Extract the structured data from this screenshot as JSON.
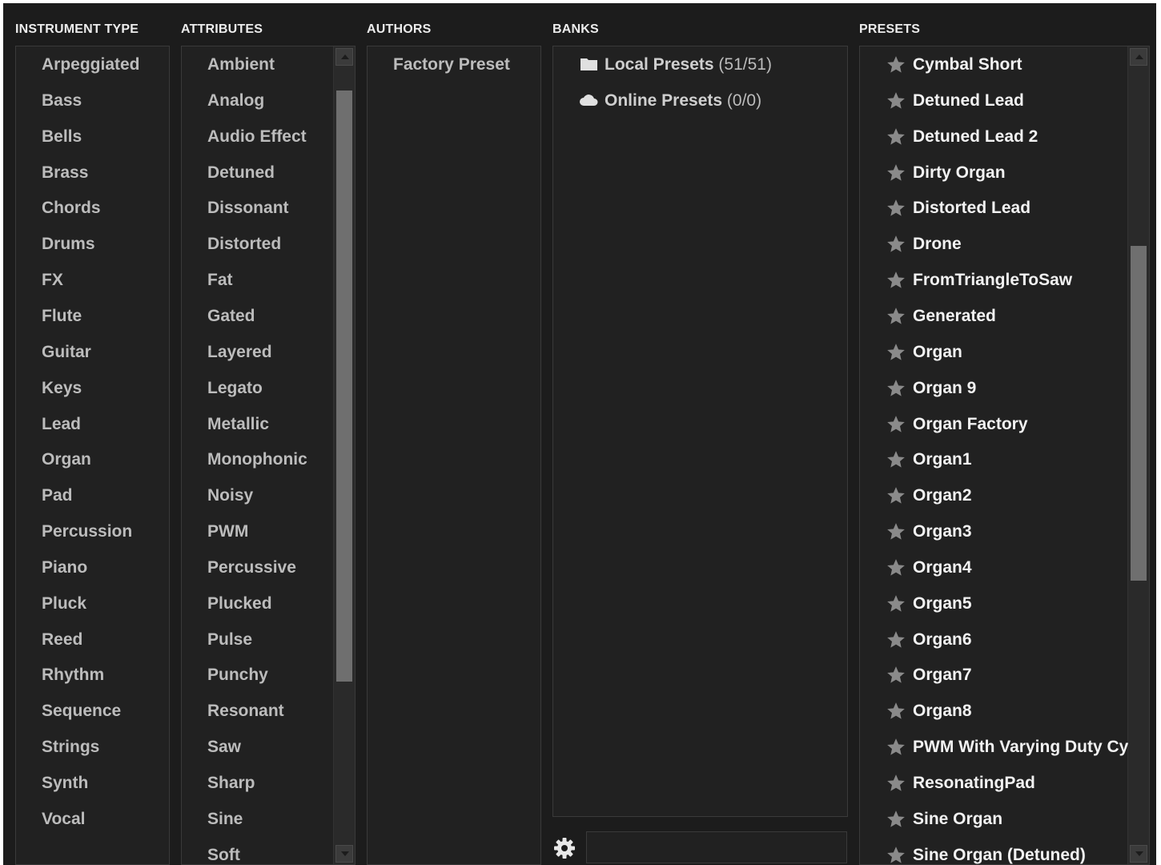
{
  "headers": {
    "instrument_type": "INSTRUMENT TYPE",
    "attributes": "ATTRIBUTES",
    "authors": "AUTHORS",
    "banks": "BANKS",
    "presets": "PRESETS"
  },
  "instrument_types": [
    "Arpeggiated",
    "Bass",
    "Bells",
    "Brass",
    "Chords",
    "Drums",
    "FX",
    "Flute",
    "Guitar",
    "Keys",
    "Lead",
    "Organ",
    "Pad",
    "Percussion",
    "Piano",
    "Pluck",
    "Reed",
    "Rhythm",
    "Sequence",
    "Strings",
    "Synth",
    "Vocal"
  ],
  "attributes": [
    "Ambient",
    "Analog",
    "Audio Effect",
    "Detuned",
    "Dissonant",
    "Distorted",
    "Fat",
    "Gated",
    "Layered",
    "Legato",
    "Metallic",
    "Monophonic",
    "Noisy",
    "PWM",
    "Percussive",
    "Plucked",
    "Pulse",
    "Punchy",
    "Resonant",
    "Saw",
    "Sharp",
    "Sine",
    "Soft"
  ],
  "authors": [
    "Factory Preset"
  ],
  "banks": [
    {
      "label": "Local Presets",
      "count": "(51/51)",
      "icon": "folder-icon"
    },
    {
      "label": "Online Presets",
      "count": "(0/0)",
      "icon": "cloud-icon"
    }
  ],
  "presets": [
    "Cymbal Short",
    "Detuned Lead",
    "Detuned Lead 2",
    "Dirty Organ",
    "Distorted Lead",
    "Drone",
    "FromTriangleToSaw",
    "Generated",
    "Organ",
    "Organ 9",
    "Organ Factory",
    "Organ1",
    "Organ2",
    "Organ3",
    "Organ4",
    "Organ5",
    "Organ6",
    "Organ7",
    "Organ8",
    "PWM With Varying Duty Cycle",
    "ResonatingPad",
    "Sine Organ",
    "Sine Organ (Detuned)"
  ],
  "search": {
    "value": "",
    "icon": "gear-icon"
  },
  "scroll": {
    "attributes_visible_fraction": [
      0.03,
      0.79
    ],
    "presets_visible_fraction": [
      0.23,
      0.66
    ]
  },
  "colors": {
    "background": "#1c1c1c",
    "panel": "#212121",
    "text": "#bcbcbc",
    "preset_text": "#f2f2f2",
    "star": "#8a8a8a"
  }
}
